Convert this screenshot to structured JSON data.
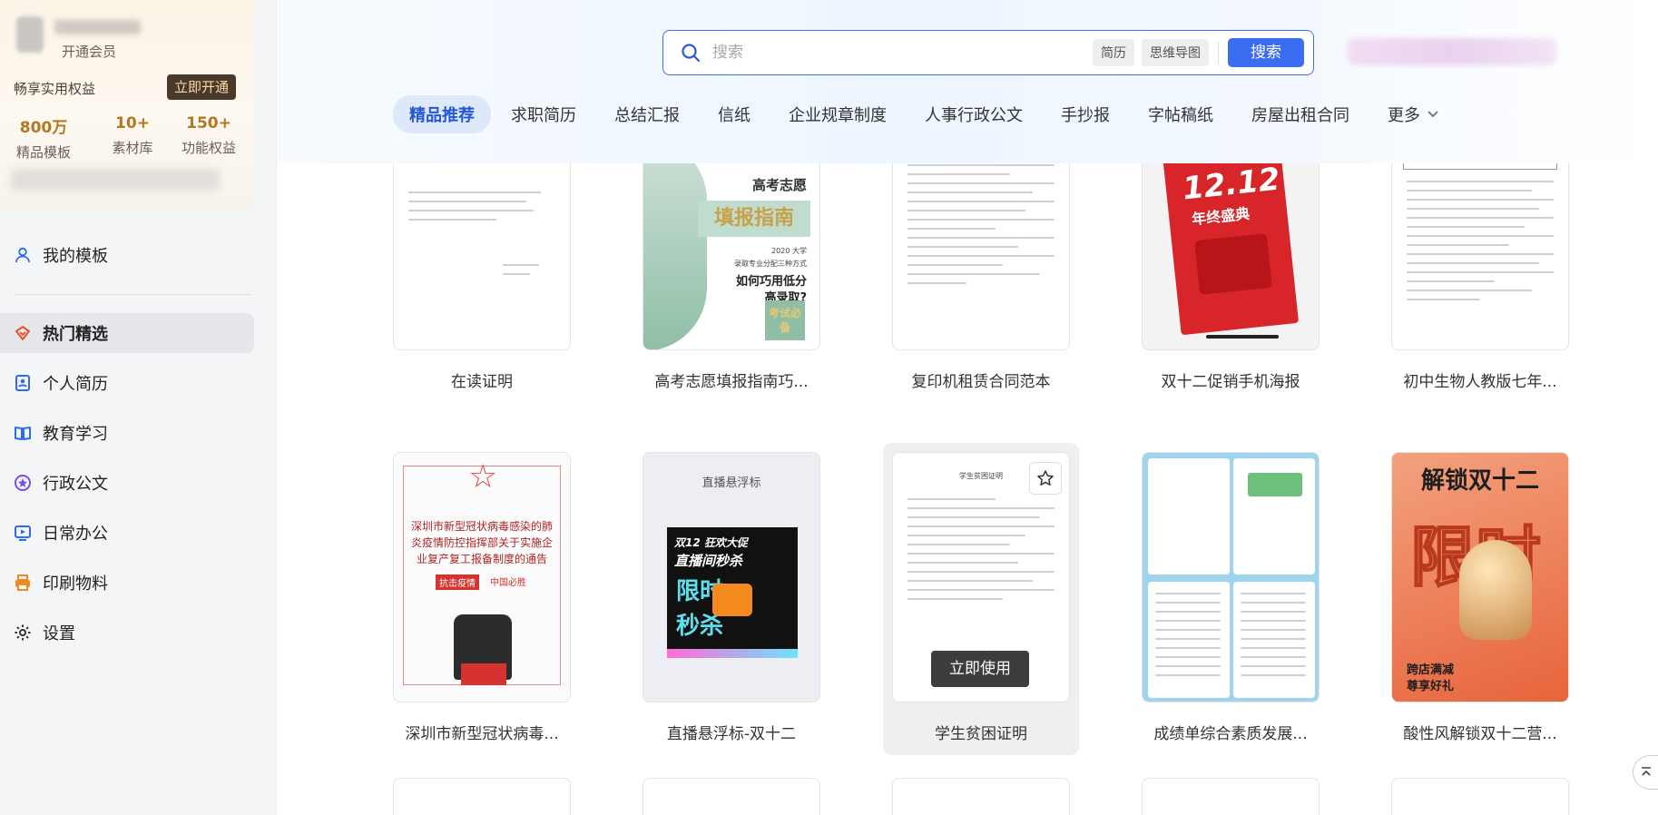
{
  "sidebar": {
    "member": {
      "tag": "开通会员",
      "benefit_text": "畅享实用权益",
      "open_button": "立即开通",
      "stats": [
        {
          "num": "800万",
          "label": "精品模板"
        },
        {
          "num": "10+",
          "label": "素材库"
        },
        {
          "num": "150+",
          "label": "功能权益"
        }
      ]
    },
    "my_templates": "我的模板",
    "items": [
      {
        "label": "热门精选",
        "icon": "fire-icon",
        "active": true
      },
      {
        "label": "个人简历",
        "icon": "resume-icon"
      },
      {
        "label": "教育学习",
        "icon": "book-icon"
      },
      {
        "label": "行政公文",
        "icon": "badge-icon"
      },
      {
        "label": "日常办公",
        "icon": "monitor-play-icon"
      },
      {
        "label": "印刷物料",
        "icon": "printer-icon"
      },
      {
        "label": "设置",
        "icon": "gear-icon"
      }
    ]
  },
  "search": {
    "placeholder": "搜索",
    "chips": [
      "简历",
      "思维导图"
    ],
    "button": "搜索"
  },
  "tabs": [
    "精品推荐",
    "求职简历",
    "总结汇报",
    "信纸",
    "企业规章制度",
    "人事行政公文",
    "手抄报",
    "字帖稿纸",
    "房屋出租合同",
    "更多"
  ],
  "row1": [
    {
      "title": "在读证明"
    },
    {
      "title": "高考志愿填报指南巧..."
    },
    {
      "title": "复印机租赁合同范本"
    },
    {
      "title": "双十二促销手机海报"
    },
    {
      "title": "初中生物人教版七年..."
    }
  ],
  "row2": [
    {
      "title": "深圳市新型冠状病毒..."
    },
    {
      "title": "直播悬浮标-双十二"
    },
    {
      "title": "学生贫困证明"
    },
    {
      "title": "成绩单综合素质发展..."
    },
    {
      "title": "酸性风解锁双十二营..."
    }
  ],
  "thumbs": {
    "gaokao": {
      "l1": "高考志愿",
      "l2": "填报指南",
      "l3": "2020 大学",
      "l4": "录取专业分配三种方式",
      "l5": "如何巧用低分",
      "l6": "高录取?",
      "seal": "考试必备"
    },
    "poster1212": {
      "date": "12.12",
      "sub": "年终盛典"
    },
    "covid": {
      "text": "深圳市新型冠状病毒感染的肺炎疫情防控指挥部关于实施企业复产复工报备制度的通告",
      "tag1": "抗击疫情",
      "tag2": "中国必胜"
    },
    "live": {
      "header": "直播悬浮标",
      "l1": "双12 狂欢大促",
      "l2": "直播间秒杀",
      "l3": "限时",
      "l4": "秒杀"
    },
    "poverty": {
      "title": "学生贫困证明",
      "use_button": "立即使用"
    },
    "acid": {
      "title": "解锁双十二",
      "big": "限时",
      "foot1": "跨店满减",
      "foot2": "尊享好礼"
    }
  }
}
